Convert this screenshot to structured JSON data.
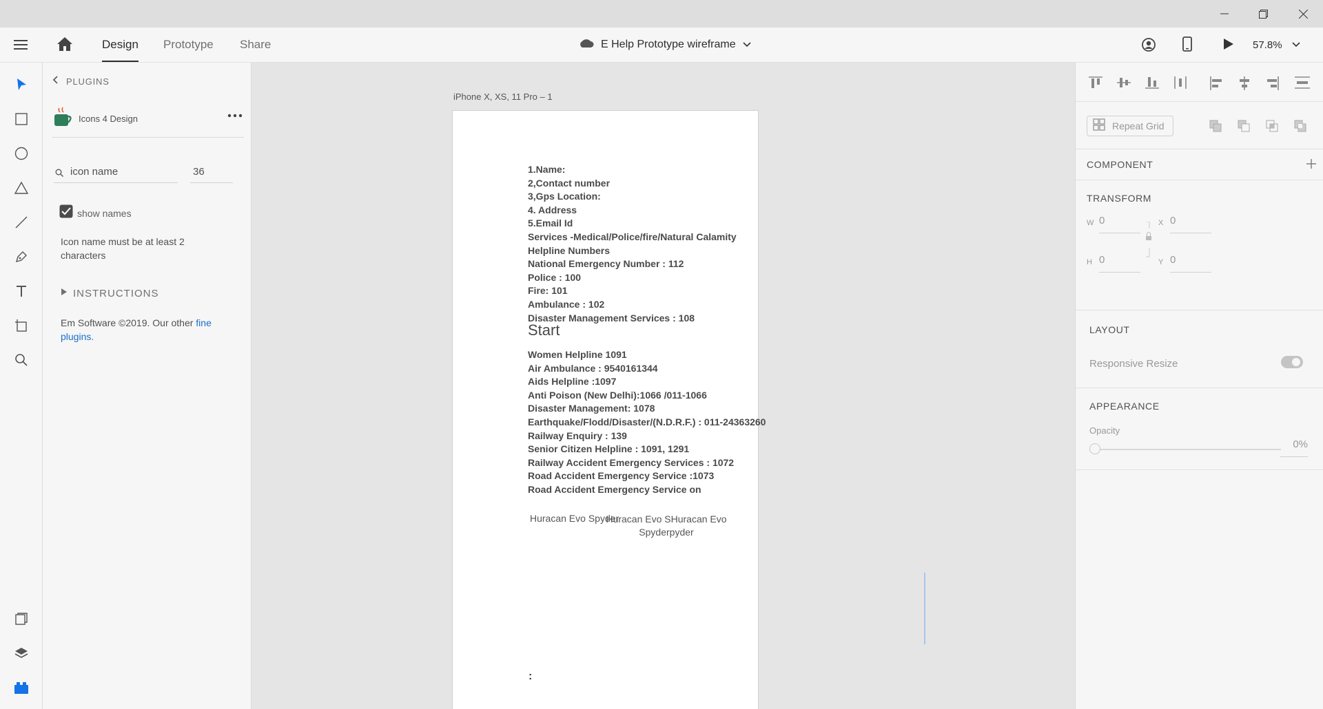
{
  "window": {
    "minimize_icon": "minimize-icon",
    "restore_icon": "restore-icon",
    "close_icon": "close-icon"
  },
  "toolbar": {
    "menu_icon": "hamburger-menu-icon",
    "home_icon": "home-icon",
    "tabs": [
      {
        "label": "Design",
        "active": true
      },
      {
        "label": "Prototype",
        "active": false
      },
      {
        "label": "Share",
        "active": false
      }
    ],
    "document_title": "E Help Prototype wireframe",
    "cloud_icon": "cloud-icon",
    "chevron_icon": "chevron-down-icon",
    "share_user_icon": "user-share-icon",
    "device_icon": "mobile-device-icon",
    "play_icon": "play-icon",
    "zoom": "57.8%"
  },
  "tools": [
    "select-icon",
    "rectangle-icon",
    "ellipse-icon",
    "polygon-icon",
    "line-icon",
    "pen-icon",
    "text-icon",
    "artboard-icon",
    "zoom-icon"
  ],
  "bottom_tools": [
    "assets-icon",
    "layers-icon",
    "plugins-icon"
  ],
  "plugins_panel": {
    "back_label": "PLUGINS",
    "plugin_name": "Icons 4 Design",
    "search_placeholder": "icon name",
    "size_value": "36",
    "show_names_label": "show names",
    "show_names_checked": true,
    "validation_message": "Icon name must be at least 2 characters",
    "instructions_label": "INSTRUCTIONS",
    "footer_text": "Em Software ©2019. Our other ",
    "footer_link": "fine plugins",
    "footer_end": "."
  },
  "artboard": {
    "title": "iPhone X, XS, 11 Pro – 1",
    "lines": [
      "1.Name:",
      "2,Contact number",
      "3,Gps Location:",
      "4. Address",
      "5.Email Id",
      "Services -Medical/Police/fire/Natural Calamity",
      "Helpline Numbers",
      "National Emergency Number :  112",
      "Police : 100",
      "Fire: 101",
      "Ambulance : 102",
      "Disaster Management Services : 108"
    ],
    "start_label": "Start",
    "lines2": [
      " Women Helpline 1091",
      "Air Ambulance : 9540161344",
      "Aids Helpline :1097",
      "Anti Poison (New Delhi):1066 /011-1066",
      "Disaster Management: 1078",
      "Earthquake/Flodd/Disaster/(N.D.R.F.) : 011-24363260",
      "Railway Enquiry : 139",
      "Senior Citizen Helpline : 1091, 1291",
      "Railway Accident Emergency Services : 1072",
      "Road Accident Emergency Service :1073",
      "Road Accident Emergency Service on"
    ],
    "caption_left": "Huracan Evo Spyder",
    "caption_right_1": "Huracan Evo SHuracan Evo",
    "caption_right_2": "Spyderpyder",
    "colon": ":"
  },
  "right_panel": {
    "align_icons": [
      "align-top-icon",
      "align-middle-icon",
      "align-bottom-icon",
      "distribute-vertical-icon",
      "align-left-icon",
      "align-center-icon",
      "align-right-icon",
      "distribute-horizontal-icon"
    ],
    "repeat_grid_label": "Repeat Grid",
    "component_label": "COMPONENT",
    "transform_label": "TRANSFORM",
    "w_label": "W",
    "w_value": "0",
    "x_label": "X",
    "x_value": "0",
    "h_label": "H",
    "h_value": "0",
    "y_label": "Y",
    "y_value": "0",
    "layout_label": "LAYOUT",
    "responsive_resize_label": "Responsive Resize",
    "appearance_label": "APPEARANCE",
    "opacity_label": "Opacity",
    "opacity_value": "0%"
  },
  "colors": {
    "accent_blue": "#1473e6",
    "plugin_icon_green": "#2e7d5b",
    "link_blue": "#1a6fc9"
  }
}
